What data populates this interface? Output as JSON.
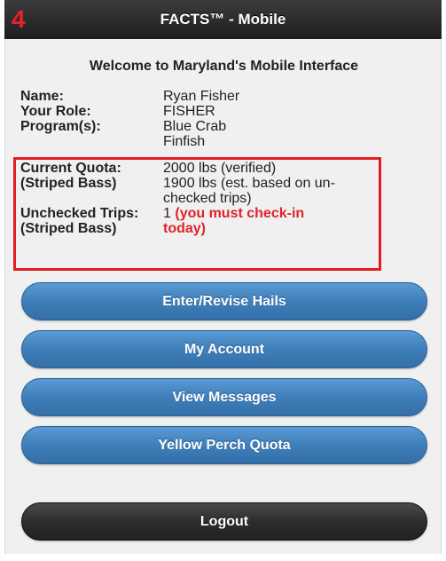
{
  "header": {
    "step_number": "4",
    "title": "FACTS™ - Mobile"
  },
  "welcome": "Welcome to Maryland's Mobile Interface",
  "profile": {
    "name_label": "Name:",
    "name_value": "Ryan Fisher",
    "role_label": "Your Role:",
    "role_value": "FISHER",
    "programs_label": "Program(s):",
    "programs": [
      "Blue Crab",
      "Finfish"
    ]
  },
  "quota": {
    "current_label_1": "Current Quota:",
    "current_label_2": "(Striped Bass)",
    "current_value_1": "2000 lbs (verified)",
    "current_value_2a": "1900 lbs (est. based on un-",
    "current_value_2b": "checked trips)",
    "unchecked_label_1": "Unchecked Trips:",
    "unchecked_label_2": "(Striped Bass)",
    "unchecked_count": "1",
    "unchecked_warning_1": "(you must check-in",
    "unchecked_warning_2": "today)"
  },
  "buttons": {
    "enter_revise_hails": "Enter/Revise Hails",
    "my_account": "My Account",
    "view_messages": "View Messages",
    "yellow_perch_quota": "Yellow Perch Quota",
    "logout": "Logout"
  },
  "colors": {
    "header_bg": "#2a2a2a",
    "button_blue": "#3f7fb9",
    "alert_red": "#e0222a",
    "highlight_border": "#e51c24"
  }
}
